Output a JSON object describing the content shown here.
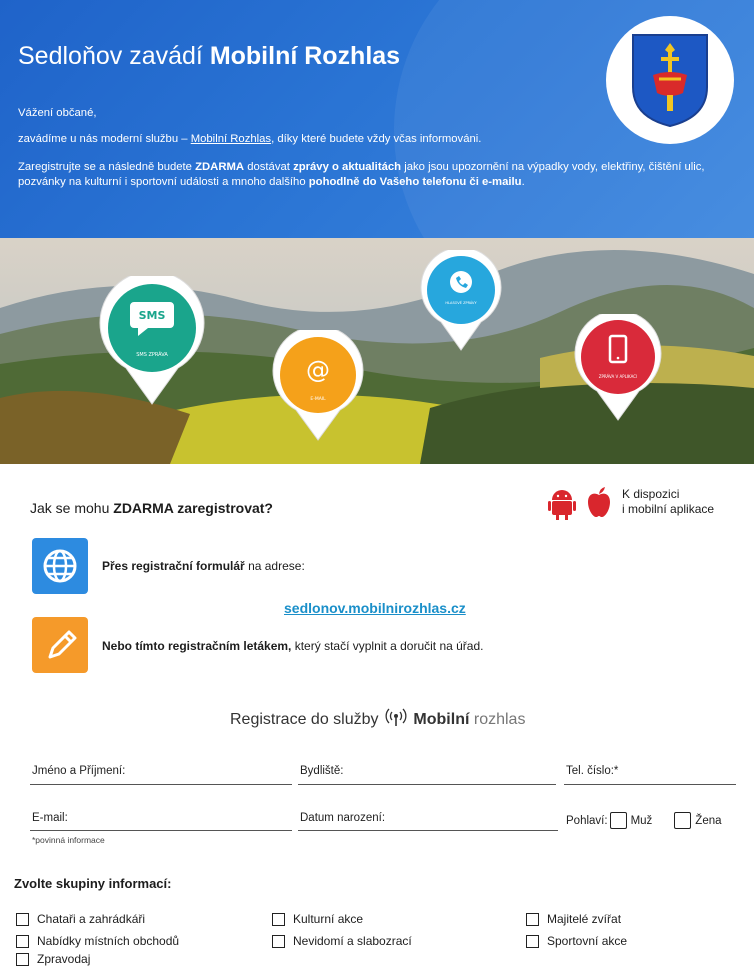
{
  "header": {
    "title_prefix": "Sedloňov zavádí",
    "title_bold": "Mobilní Rozhlas",
    "greeting": "Vážení občané,",
    "intro_a": "zavádíme u nás moderní službu –",
    "intro_link": "Mobilní Rozhlas",
    "intro_b": ", díky které budete vždy včas informováni.",
    "p2_a": "Zaregistrujte se a následně budete",
    "p2_b1": "ZDARMA",
    "p2_c": "dostávat",
    "p2_b2": "zprávy o aktualitách",
    "p2_d": "jako jsou upozornění na výpadky vody, elektřiny, čištění ulic, pozvánky na kulturní i sportovní události a mnoho dalšího",
    "p2_b3": "pohodlně do Vašeho telefonu či e-mailu",
    "p2_end": "."
  },
  "pins": {
    "sms_glyph": "SMS",
    "sms_label": "SMS ZPRÁVA",
    "mail_glyph": "@",
    "mail_label": "E-MAIL",
    "call_label": "HLASOVÉ ZPRÁVY",
    "app_label": "ZPRÁVA V APLIKACI"
  },
  "how": {
    "title_a": "Jak se mohu",
    "title_b": "ZDARMA zaregistrovat?",
    "apps_line1": "K dispozici",
    "apps_line2": "i mobilní aplikace",
    "opt1_bold": "Přes registrační formulář",
    "opt1_rest": " na adrese:",
    "url": "sedlonov.mobilnirozhlas.cz",
    "opt2_bold": "Nebo tímto registračním letákem,",
    "opt2_rest": " který stačí vyplnit a doručit na úřad."
  },
  "form": {
    "heading_a": "Registrace do služby",
    "heading_brand": "Mobilní",
    "heading_brand2": "rozhlas",
    "name_label": "Jméno a Příjmení:",
    "address_label": "Bydliště:",
    "phone_label": "Tel. číslo:*",
    "email_label": "E-mail:",
    "birth_label": "Datum narození:",
    "gender_label": "Pohlaví:",
    "male_label": "Muž",
    "female_label": "Žena",
    "required_note": "*povinná informace",
    "groups_title": "Zvolte skupiny informací:",
    "groups": [
      "Chataři a zahrádkáři",
      "Kulturní akce",
      "Majitelé zvířat",
      "Nabídky místních obchodů",
      "Nevidomí a slabozrací",
      "Sportovní akce",
      "Zpravodaj"
    ]
  },
  "colors": {
    "header_blue": "#2a6fd0",
    "link_blue": "#1a8fc9",
    "sms_teal": "#1aa58c",
    "mail_orange": "#f5a11a",
    "call_blue": "#27a7dd",
    "app_red": "#d92a3a"
  }
}
